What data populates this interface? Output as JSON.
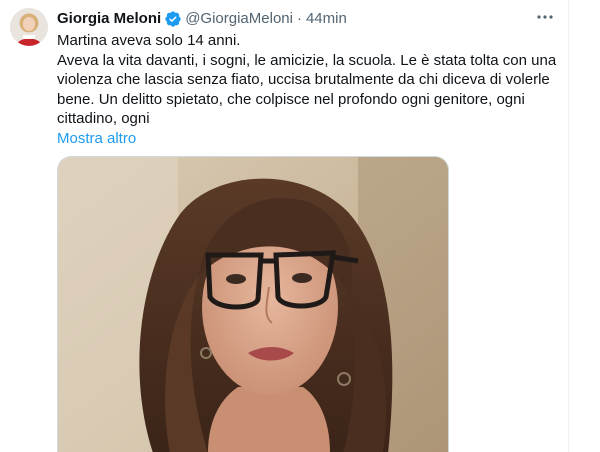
{
  "tweet": {
    "author": {
      "display_name": "Giorgia Meloni",
      "handle": "@GiorgiaMeloni",
      "verified": true
    },
    "separator": "·",
    "time_ago": "44min",
    "more_icon": "more-horizontal-icon",
    "text_lines": [
      "Martina aveva solo 14 anni.",
      "Aveva la vita davanti, i sogni, le amicizie, la scuola. Le è stata tolta con una violenza che lascia senza fiato, uccisa brutalmente da chi diceva di volerle bene. Un delitto spietato, che colpisce nel profondo ogni genitore, ogni cittadino, ogni"
    ],
    "show_more_label": "Mostra altro",
    "media": {
      "type": "photo"
    }
  },
  "colors": {
    "text_primary": "#0f1419",
    "text_secondary": "#536471",
    "link": "#1d9bf0",
    "verified_badge": "#1d9bf0",
    "divider": "#eff3f4"
  }
}
